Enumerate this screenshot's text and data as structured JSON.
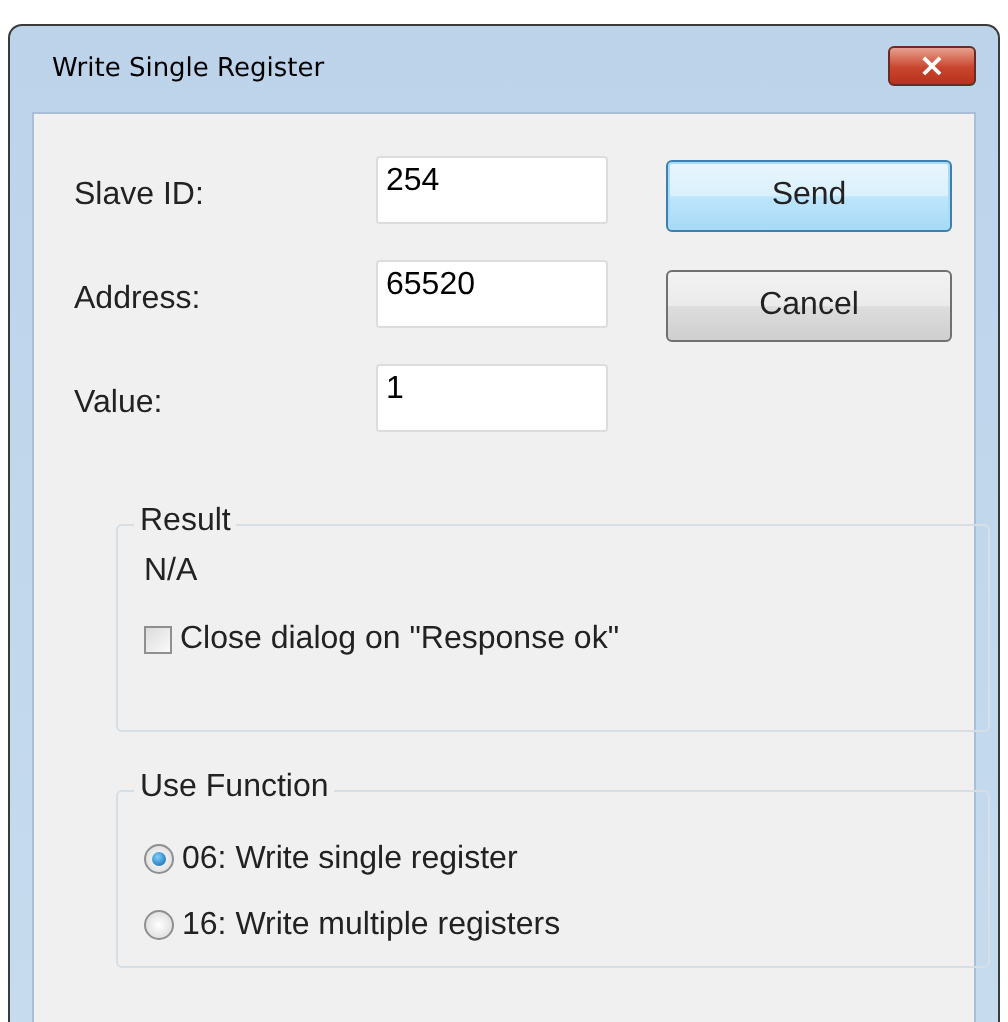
{
  "window": {
    "title": "Write Single Register",
    "close": "×"
  },
  "fields": [
    {
      "label": "Slave ID:",
      "value": "254"
    },
    {
      "label": "Address:",
      "value": "65520"
    },
    {
      "label": "Value:",
      "value": "1"
    }
  ],
  "buttons": [
    {
      "label": "Send",
      "default": true
    },
    {
      "label": "Cancel",
      "default": false
    }
  ],
  "result": {
    "title": "Result",
    "text": "N/A",
    "checkbox": {
      "label": "Close dialog on \"Response ok\"",
      "checked": false
    }
  },
  "use_function": {
    "title": "Use Function",
    "options": [
      {
        "label": "06: Write single register",
        "selected": true
      },
      {
        "label": "16: Write multiple registers",
        "selected": false
      }
    ]
  }
}
